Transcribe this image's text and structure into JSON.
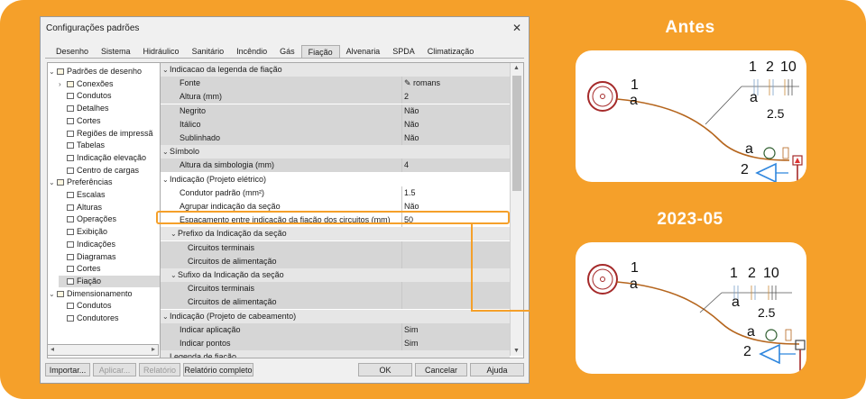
{
  "dialog": {
    "title": "Configurações padrões",
    "close": "✕",
    "tabs": [
      "Desenho",
      "Sistema",
      "Hidráulico",
      "Sanitário",
      "Incêndio",
      "Gás",
      "Fiação",
      "Alvenaria",
      "SPDA",
      "Climatização"
    ],
    "active_tab": "Fiação",
    "tree": [
      {
        "label": "Padrões de desenho",
        "level": 0,
        "expanded": true,
        "icon": "folder-icon"
      },
      {
        "label": "Conexões",
        "level": 1,
        "expandable": true,
        "icon": "folder-icon"
      },
      {
        "label": "Condutos",
        "level": 1,
        "icon": "item-icon"
      },
      {
        "label": "Detalhes",
        "level": 1,
        "icon": "item-icon"
      },
      {
        "label": "Cortes",
        "level": 1,
        "icon": "item-icon"
      },
      {
        "label": "Regiões de impressã",
        "level": 1,
        "icon": "item-icon"
      },
      {
        "label": "Tabelas",
        "level": 1,
        "icon": "item-icon"
      },
      {
        "label": "Indicação elevação",
        "level": 1,
        "icon": "item-icon"
      },
      {
        "label": "Centro de cargas",
        "level": 1,
        "icon": "item-icon"
      },
      {
        "label": "Preferências",
        "level": 0,
        "expanded": true,
        "icon": "folder-icon"
      },
      {
        "label": "Escalas",
        "level": 1,
        "icon": "item-icon"
      },
      {
        "label": "Alturas",
        "level": 1,
        "icon": "item-icon"
      },
      {
        "label": "Operações",
        "level": 1,
        "icon": "item-icon"
      },
      {
        "label": "Exibição",
        "level": 1,
        "icon": "item-icon"
      },
      {
        "label": "Indicações",
        "level": 1,
        "icon": "item-icon"
      },
      {
        "label": "Diagramas",
        "level": 1,
        "icon": "item-icon"
      },
      {
        "label": "Cortes",
        "level": 1,
        "icon": "item-icon"
      },
      {
        "label": "Fiação",
        "level": 1,
        "icon": "item-icon",
        "selected": true
      },
      {
        "label": "Dimensionamento",
        "level": 0,
        "expanded": true,
        "icon": "folder-icon"
      },
      {
        "label": "Condutos",
        "level": 1,
        "icon": "item-icon"
      },
      {
        "label": "Condutores",
        "level": 1,
        "icon": "item-icon"
      }
    ],
    "properties": [
      {
        "type": "category",
        "label": "Indicacao da legenda de fiação",
        "indent": 0
      },
      {
        "type": "prop",
        "label": "Fonte",
        "value": "romans",
        "value_icon": "font-icon"
      },
      {
        "type": "prop",
        "label": "Altura (mm)",
        "value": "2"
      },
      {
        "type": "prop",
        "label": "Negrito",
        "value": "Não"
      },
      {
        "type": "prop",
        "label": "Itálico",
        "value": "Não"
      },
      {
        "type": "prop",
        "label": "Sublinhado",
        "value": "Não"
      },
      {
        "type": "category",
        "label": "Símbolo",
        "indent": 0
      },
      {
        "type": "prop",
        "label": "Altura da simbologia (mm)",
        "value": "4"
      },
      {
        "type": "category",
        "label": "Indicação (Projeto elétrico)",
        "indent": 0,
        "white": true
      },
      {
        "type": "prop",
        "label": "Condutor padrão (mm²)",
        "value": "1.5",
        "white": true
      },
      {
        "type": "prop",
        "label": "Agrupar indicação da seção",
        "value": "Não",
        "white": true
      },
      {
        "type": "prop",
        "label": "Espaçamento entre indicação da fiação dos circuitos (mm)",
        "value": "50",
        "white": true,
        "highlight": true
      },
      {
        "type": "category",
        "label": "Prefixo da Indicação da seção",
        "indent": 1
      },
      {
        "type": "prop",
        "label": "Circuitos terminais",
        "value": "",
        "indent": 2
      },
      {
        "type": "prop",
        "label": "Circuitos de alimentação",
        "value": "",
        "indent": 2
      },
      {
        "type": "category",
        "label": "Sufixo da Indicação da seção",
        "indent": 1
      },
      {
        "type": "prop",
        "label": "Circuitos terminais",
        "value": "",
        "indent": 2
      },
      {
        "type": "prop",
        "label": "Circuitos de alimentação",
        "value": "",
        "indent": 2
      },
      {
        "type": "category",
        "label": "Indicação (Projeto de cabeamento)",
        "indent": 0
      },
      {
        "type": "prop",
        "label": "Indicar aplicação",
        "value": "Sim"
      },
      {
        "type": "prop",
        "label": "Indicar pontos",
        "value": "Sim"
      },
      {
        "type": "category",
        "label": "Legenda de fiação",
        "indent": 0
      }
    ],
    "buttons_left": [
      {
        "label": "Importar...",
        "enabled": true
      },
      {
        "label": "Aplicar...",
        "enabled": false
      },
      {
        "label": "Relatório",
        "enabled": false
      },
      {
        "label": "Relatório completo",
        "enabled": true
      }
    ],
    "buttons_right": [
      {
        "label": "OK"
      },
      {
        "label": "Cancelar"
      },
      {
        "label": "Ajuda"
      }
    ]
  },
  "before": {
    "title": "Antes",
    "labels": {
      "num1": "1",
      "a1": "a",
      "n_1": "1",
      "n_2": "2",
      "n_10": "10",
      "a_top": "a",
      "size": "2.5",
      "a_bottom": "a",
      "two": "2"
    }
  },
  "after": {
    "title": "2023-05",
    "labels": {
      "num1": "1",
      "a1": "a",
      "n_1": "1",
      "n_2": "2",
      "n_10": "10",
      "a_top": "a",
      "size": "2.5",
      "a_bottom": "a",
      "two": "2"
    }
  },
  "colors": {
    "accent": "#f5a02a",
    "wire": "#b5651d",
    "pipe_red": "#a52a2a",
    "blue": "#2e86de",
    "green": "#2e5d2e"
  }
}
